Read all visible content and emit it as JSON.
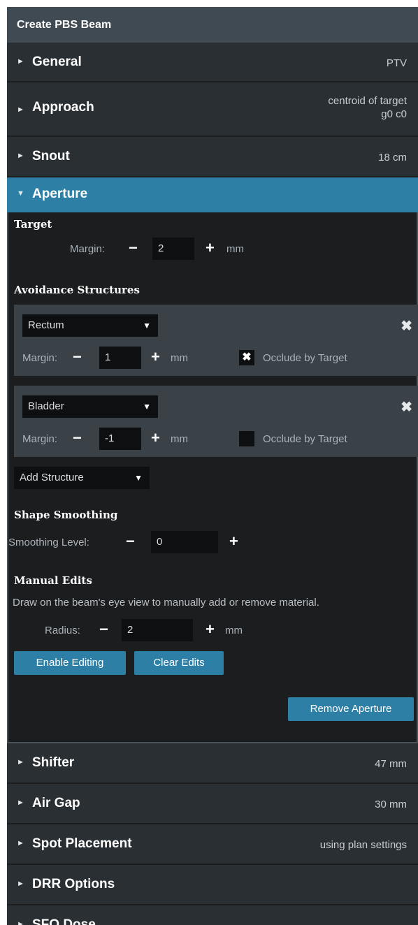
{
  "title": "Create PBS Beam",
  "sections_top": [
    {
      "name": "General",
      "value": "PTV"
    },
    {
      "name": "Approach",
      "value_line1": "centroid of target",
      "value_line2": "g0 c0"
    },
    {
      "name": "Snout",
      "value": "18 cm"
    }
  ],
  "aperture": {
    "name": "Aperture",
    "target": {
      "heading": "Target",
      "margin_label": "Margin:",
      "margin_value": "2",
      "unit": "mm"
    },
    "avoidance": {
      "heading": "Avoidance Structures",
      "items": [
        {
          "structure": "Rectum",
          "margin_label": "Margin:",
          "margin_value": "1",
          "unit": "mm",
          "occlude_label": "Occlude by Target",
          "occlude_checked": true
        },
        {
          "structure": "Bladder",
          "margin_label": "Margin:",
          "margin_value": "-1",
          "unit": "mm",
          "occlude_label": "Occlude by Target",
          "occlude_checked": false
        }
      ],
      "add_label": "Add Structure"
    },
    "smoothing": {
      "heading": "Shape Smoothing",
      "label": "Smoothing Level:",
      "value": "0"
    },
    "manual": {
      "heading": "Manual Edits",
      "description": "Draw on the beam's eye view to manually add or remove material.",
      "radius_label": "Radius:",
      "radius_value": "2",
      "unit": "mm",
      "enable_label": "Enable Editing",
      "clear_label": "Clear Edits"
    },
    "remove_label": "Remove Aperture"
  },
  "sections_bottom": [
    {
      "name": "Shifter",
      "value": "47 mm"
    },
    {
      "name": "Air Gap",
      "value": "30 mm"
    },
    {
      "name": "Spot Placement",
      "value": "using plan settings"
    },
    {
      "name": "DRR Options",
      "value": ""
    },
    {
      "name": "SFO Dose",
      "value": ""
    }
  ],
  "symbols": {
    "collapsed": "►",
    "expanded": "▼",
    "minus": "−",
    "plus": "+",
    "close": "✖",
    "check": "✖",
    "caret": "▼"
  },
  "colors": {
    "accent": "#2d7fa6",
    "header": "#3f4a53",
    "section": "#2a2f33",
    "background": "#1b1d1f"
  }
}
